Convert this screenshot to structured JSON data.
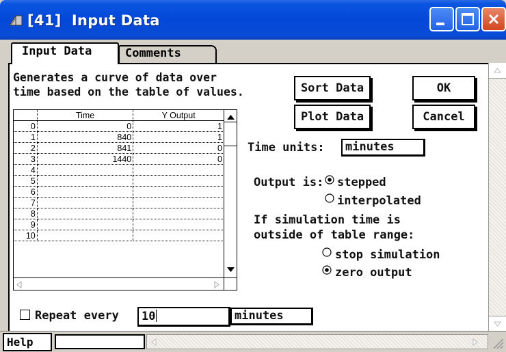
{
  "window": {
    "title": "[41]  Input Data"
  },
  "tabs": [
    {
      "label": "Input Data",
      "active": true
    },
    {
      "label": "Comments",
      "active": false
    }
  ],
  "description": "Generates a curve of data over\ntime based on the table of values.",
  "buttons": {
    "sort": "Sort Data",
    "plot": "Plot Data",
    "ok": "OK",
    "cancel": "Cancel"
  },
  "table": {
    "columns": [
      "Time",
      "Y Output"
    ],
    "rows": [
      {
        "idx": "0",
        "time": "0",
        "y": "1"
      },
      {
        "idx": "1",
        "time": "840",
        "y": "1"
      },
      {
        "idx": "2",
        "time": "841",
        "y": "0"
      },
      {
        "idx": "3",
        "time": "1440",
        "y": "0"
      },
      {
        "idx": "4",
        "time": "",
        "y": ""
      },
      {
        "idx": "5",
        "time": "",
        "y": ""
      },
      {
        "idx": "6",
        "time": "",
        "y": ""
      },
      {
        "idx": "7",
        "time": "",
        "y": ""
      },
      {
        "idx": "8",
        "time": "",
        "y": ""
      },
      {
        "idx": "9",
        "time": "",
        "y": ""
      },
      {
        "idx": "10",
        "time": "",
        "y": ""
      }
    ]
  },
  "time_units": {
    "label": "Time units:",
    "value": "minutes"
  },
  "output": {
    "label": "Output is:",
    "options": [
      "stepped",
      "interpolated"
    ],
    "selected": "stepped"
  },
  "range": {
    "label": "If simulation time is\noutside of table range:",
    "options": [
      "stop simulation",
      "zero output"
    ],
    "selected": "zero output"
  },
  "repeat": {
    "label": "Repeat every",
    "checked": false,
    "value": "10",
    "units": "minutes"
  },
  "help": {
    "label": "Help"
  },
  "colors": {
    "title_bar": "#0348d8",
    "close_button": "#d2461e",
    "panel": "#ffffff"
  }
}
